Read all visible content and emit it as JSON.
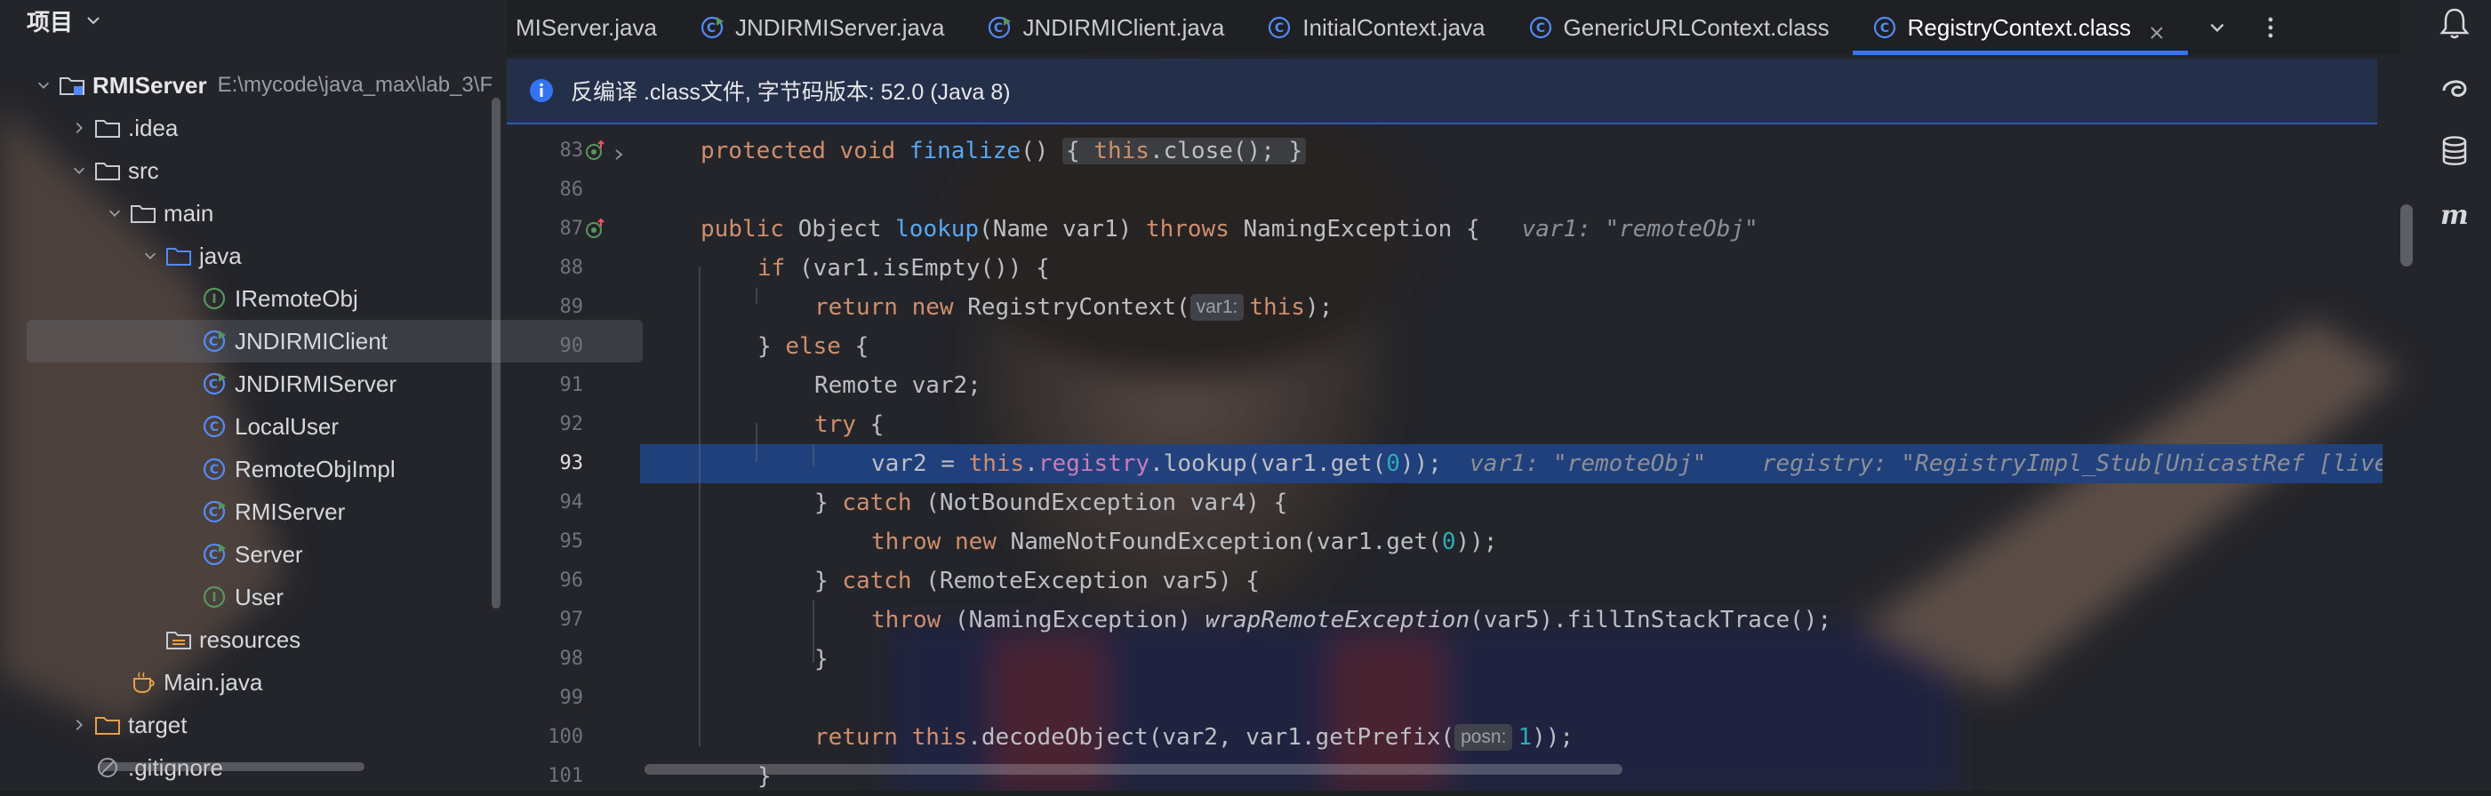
{
  "project_panel": {
    "title": "项目",
    "tree": [
      {
        "label": "RMIServer",
        "path": "E:\\mycode\\java_max\\lab_3\\F",
        "icon": "module-folder-icon",
        "arrow": "down",
        "indent": 0
      },
      {
        "label": ".idea",
        "icon": "folder-icon",
        "arrow": "right",
        "indent": 1
      },
      {
        "label": "src",
        "icon": "folder-icon",
        "arrow": "down",
        "indent": 1
      },
      {
        "label": "main",
        "icon": "folder-icon",
        "arrow": "down",
        "indent": 2
      },
      {
        "label": "java",
        "icon": "source-folder-icon",
        "arrow": "down",
        "indent": 3
      },
      {
        "label": "IRemoteObj",
        "icon": "interface-icon",
        "indent": 4
      },
      {
        "label": "JNDIRMIClient",
        "icon": "class-runnable-icon",
        "indent": 4,
        "selected": true
      },
      {
        "label": "JNDIRMIServer",
        "icon": "class-runnable-icon",
        "indent": 4
      },
      {
        "label": "LocalUser",
        "icon": "class-icon",
        "indent": 4
      },
      {
        "label": "RemoteObjImpl",
        "icon": "class-icon",
        "indent": 4
      },
      {
        "label": "RMIServer",
        "icon": "class-runnable-icon",
        "indent": 4
      },
      {
        "label": "Server",
        "icon": "class-runnable-icon",
        "indent": 4
      },
      {
        "label": "User",
        "icon": "interface-icon",
        "indent": 4
      },
      {
        "label": "resources",
        "icon": "resources-folder-icon",
        "indent": 3
      },
      {
        "label": "Main.java",
        "icon": "java-file-icon",
        "indent": 2
      },
      {
        "label": "target",
        "icon": "folder-orange-icon",
        "arrow": "right",
        "indent": 1
      },
      {
        "label": ".gitignore",
        "icon": "ignore-file-icon",
        "indent": 1
      }
    ]
  },
  "tabs": [
    {
      "label": "MIServer.java",
      "icon": "none"
    },
    {
      "label": "JNDIRMIServer.java",
      "icon": "class-runnable-icon"
    },
    {
      "label": "JNDIRMIClient.java",
      "icon": "class-runnable-icon"
    },
    {
      "label": "InitialContext.java",
      "icon": "class-icon"
    },
    {
      "label": "GenericURLContext.class",
      "icon": "class-icon"
    },
    {
      "label": "RegistryContext.class",
      "icon": "class-icon",
      "active": true
    }
  ],
  "banner": {
    "text": "反编译 .class文件, 字节码版本: 52.0 (Java 8)",
    "icon": "info-icon"
  },
  "editor": {
    "current_line": "93",
    "lines": [
      {
        "num": "83",
        "marker": "override-up-icon"
      },
      {
        "num": "86"
      },
      {
        "num": "87",
        "marker": "override-icon"
      },
      {
        "num": "88"
      },
      {
        "num": "89"
      },
      {
        "num": "90"
      },
      {
        "num": "91"
      },
      {
        "num": "92"
      },
      {
        "num": "93"
      },
      {
        "num": "94"
      },
      {
        "num": "95"
      },
      {
        "num": "96"
      },
      {
        "num": "97"
      },
      {
        "num": "98"
      },
      {
        "num": "99"
      },
      {
        "num": "100"
      },
      {
        "num": "101"
      }
    ],
    "code": {
      "l83": {
        "kw1": "protected",
        "kw2": "void",
        "fn": "finalize",
        "p1": "()",
        "fold": "{ ",
        "this": "this",
        "call": ".close(); ",
        "close": "}"
      },
      "l87": {
        "kw1": "public",
        "type": "Object",
        "fn": "lookup",
        "params": "(Name var1) ",
        "kw2": "throws",
        "rest": " NamingException {",
        "hint": "var1: \"remoteObj\""
      },
      "l88": {
        "kw": "if",
        "rest": " (var1.isEmpty()) {"
      },
      "l89": {
        "kw1": "return",
        "kw2": "new",
        "mid": " RegistryContext(",
        "phint": "var1:",
        "this": "this",
        "end": ");"
      },
      "l90": {
        "a": "} ",
        "kw": "else",
        "b": " {"
      },
      "l91": {
        "text": "Remote var2;"
      },
      "l92": {
        "kw": "try",
        "b": " {"
      },
      "l93": {
        "a": "var2 = ",
        "this": "this",
        "dot": ".",
        "fld": "registry",
        "b": ".lookup(var1.get(",
        "n": "0",
        "c": "));",
        "hint1": "var1: \"remoteObj\"",
        "hint2": "registry: \"RegistryImpl_Stub[UnicastRef [live"
      },
      "l94": {
        "a": "} ",
        "kw": "catch",
        "b": " (NotBoundException var4) {"
      },
      "l95": {
        "kw1": "throw",
        "kw2": "new",
        "b": " NameNotFoundException(var1.get(",
        "n": "0",
        "c": "));"
      },
      "l96": {
        "a": "} ",
        "kw": "catch",
        "b": " (RemoteException var5) {"
      },
      "l97": {
        "kw": "throw",
        "b": " (NamingException) ",
        "it": "wrapRemoteException",
        "c": "(var5).fillInStackTrace();"
      },
      "l98": {
        "text": "}"
      },
      "l100": {
        "kw": "return",
        "this": "this",
        "b": ".decodeObject(var2, var1.getPrefix(",
        "phint": "posn:",
        "n": "1",
        "c": "));"
      },
      "l101": {
        "text": "}"
      }
    }
  },
  "right_tools": [
    "notifications-icon",
    "ai-assistant-icon",
    "database-icon",
    "maven-icon"
  ],
  "colors": {
    "accent": "#3574f0",
    "keyword": "#cf8e6d",
    "function": "#56a8f5",
    "field": "#c77dbb",
    "number": "#2aacb8",
    "highlight": "#214283"
  }
}
